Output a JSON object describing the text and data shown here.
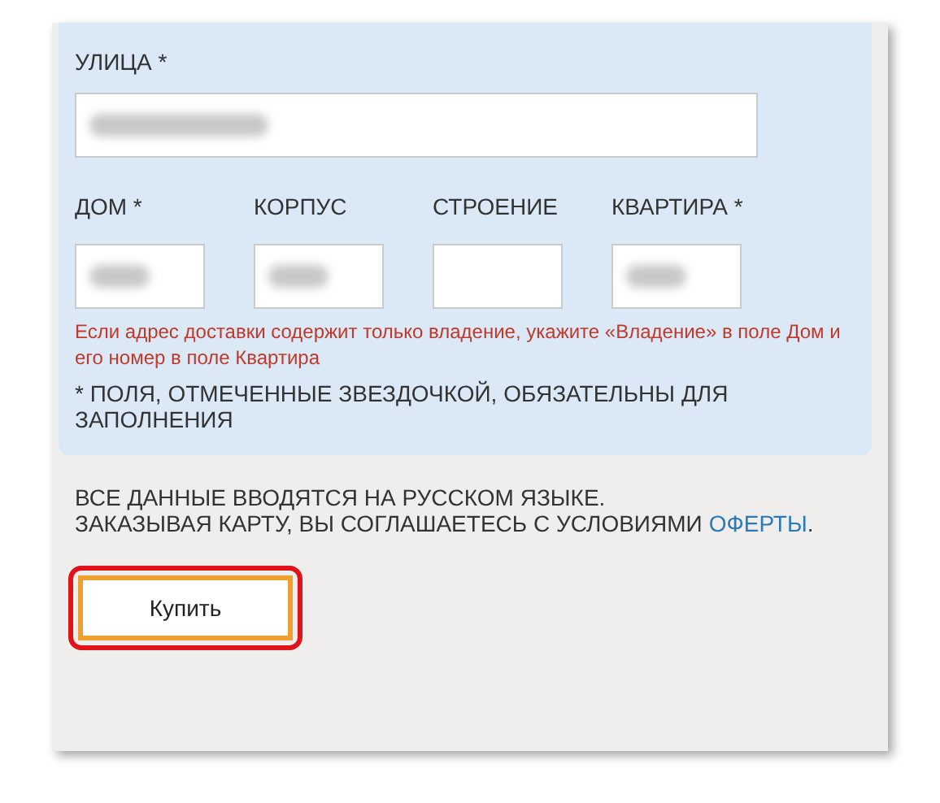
{
  "address_form": {
    "street": {
      "label": "УЛИЦА *",
      "redacted": true
    },
    "fields": [
      {
        "label": "ДОМ *",
        "redacted": true
      },
      {
        "label": "КОРПУС",
        "redacted": true
      },
      {
        "label": "СТРОЕНИЕ",
        "redacted": false
      },
      {
        "label": "КВАРТИРА *",
        "redacted": true
      }
    ],
    "hint": "Если адрес доставки содержит только владение, укажите «Владение» в поле Дом и его номер в поле Квартира",
    "required_note": "* ПОЛЯ, ОТМЕЧЕННЫЕ ЗВЕЗДОЧКОЙ, ОБЯЗАТЕЛЬНЫ ДЛЯ ЗАПОЛНЕНИЯ"
  },
  "notice": {
    "line1": "ВСЕ ДАННЫЕ ВВОДЯТСЯ НА РУССКОМ ЯЗЫКЕ.",
    "line2": "ЗАКАЗЫВАЯ КАРТУ, ВЫ СОГЛАШАЕТЕСЬ С УСЛОВИЯМИ",
    "link": "ОФЕРТЫ",
    "link_end": "."
  },
  "buy_button": {
    "label": "Купить",
    "highlighted": true
  }
}
